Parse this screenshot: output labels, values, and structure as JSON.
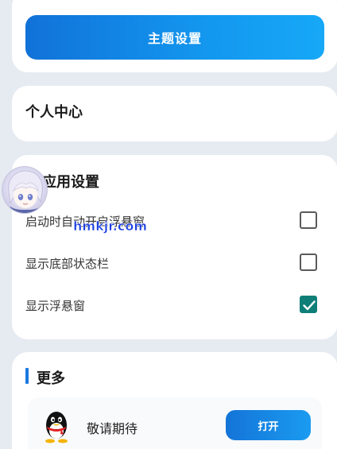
{
  "theme": {
    "button_label": "主题设置"
  },
  "personal": {
    "title": "个人中心"
  },
  "app_settings": {
    "title": "应用设置",
    "items": [
      {
        "label": "启动时自动开启浮悬窗",
        "checked": false
      },
      {
        "label": "显示底部状态栏",
        "checked": false
      },
      {
        "label": "显示浮悬窗",
        "checked": true
      }
    ]
  },
  "watermark": {
    "text": "hmkjr.com"
  },
  "more": {
    "title": "更多",
    "item": {
      "label": "敬请期待",
      "button_label": "打开",
      "icon": "qq-penguin-icon"
    }
  },
  "colors": {
    "accent": "#1397ef",
    "checkbox_checked": "#0e7f78",
    "background": "#e6ebf1"
  }
}
